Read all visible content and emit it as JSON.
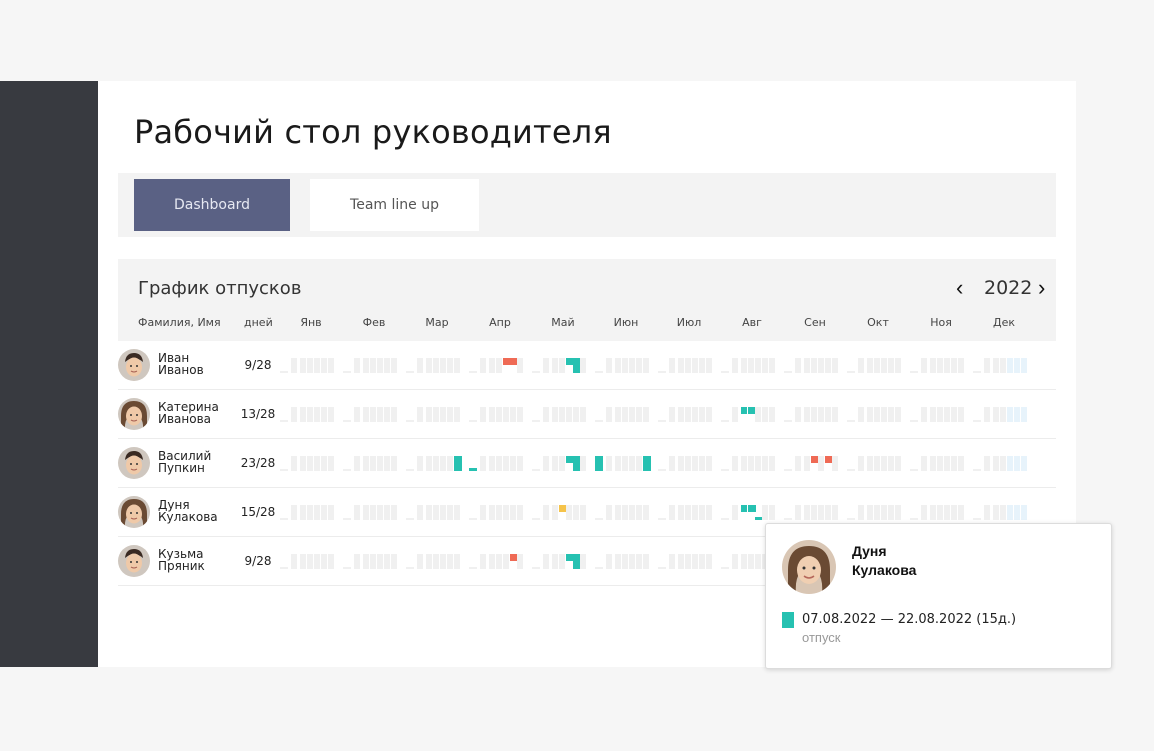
{
  "page_title": "Рабочий стол руководителя",
  "tabs": {
    "dashboard": "Dashboard",
    "team": "Team line up"
  },
  "schedule": {
    "title": "График отпусков",
    "year": "2022",
    "col_name": "Фамилия, Имя",
    "col_days": "дней",
    "months": [
      "Янв",
      "Фев",
      "Мар",
      "Апр",
      "Май",
      "Июн",
      "Июл",
      "Авг",
      "Сен",
      "Окт",
      "Ноя",
      "Дек"
    ]
  },
  "people": [
    {
      "first": "Иван",
      "last": "Иванов",
      "days": "9/28",
      "avatar": "male-avatar",
      "bars": {
        "3": [
          [
            "vacation-past",
            4,
            2
          ],
          [
            "vacation-past",
            5,
            2
          ]
        ],
        "4": [
          [
            "vacation",
            4,
            2
          ],
          [
            "vacation",
            5,
            1
          ]
        ]
      }
    },
    {
      "first": "Катерина",
      "last": "Иванова",
      "days": "13/28",
      "avatar": "female-avatar",
      "bars": {
        "7": [
          [
            "vacation",
            2,
            2
          ],
          [
            "vacation",
            3,
            2
          ]
        ]
      }
    },
    {
      "first": "Василий",
      "last": "Пупкин",
      "days": "23/28",
      "avatar": "male-avatar",
      "bars": {
        "2": [
          [
            "vacation",
            6,
            1
          ]
        ],
        "3": [
          [
            "vacation",
            0,
            0
          ]
        ],
        "4": [
          [
            "vacation",
            4,
            2
          ],
          [
            "vacation",
            5,
            1
          ]
        ],
        "5": [
          [
            "vacation",
            0,
            1
          ],
          [
            "vacation",
            6,
            1
          ]
        ],
        "8": [
          [
            "vacation-past",
            3,
            2
          ],
          [
            "vacation-past",
            5,
            2
          ]
        ]
      }
    },
    {
      "first": "Дуня",
      "last": "Кулакова",
      "days": "15/28",
      "avatar": "female-avatar",
      "bars": {
        "4": [
          [
            "vacation-planned",
            3,
            2
          ]
        ],
        "7": [
          [
            "vacation",
            2,
            2
          ],
          [
            "vacation",
            3,
            2
          ],
          [
            "vacation",
            4,
            0
          ]
        ]
      }
    },
    {
      "first": "Кузьма",
      "last": "Пряник",
      "days": "9/28",
      "avatar": "male-avatar",
      "bars": {
        "3": [
          [
            "vacation-past",
            5,
            2
          ]
        ],
        "4": [
          [
            "vacation",
            4,
            2
          ],
          [
            "vacation",
            5,
            1
          ]
        ]
      }
    }
  ],
  "colors": {
    "vacation": "#26c1b1",
    "vacation-past": "#ef6a55",
    "vacation-planned": "#f5c34a",
    "empty": "#f0f0f0",
    "december": "#e7f3fb",
    "active_tab": "#5a6184",
    "sidebar": "#383a40"
  },
  "tooltip": {
    "first": "Дуня",
    "last": "Кулакова",
    "dates": "07.08.2022 — 22.08.2022 (15д.)",
    "type": "отпуск",
    "avatar": "female-avatar"
  }
}
